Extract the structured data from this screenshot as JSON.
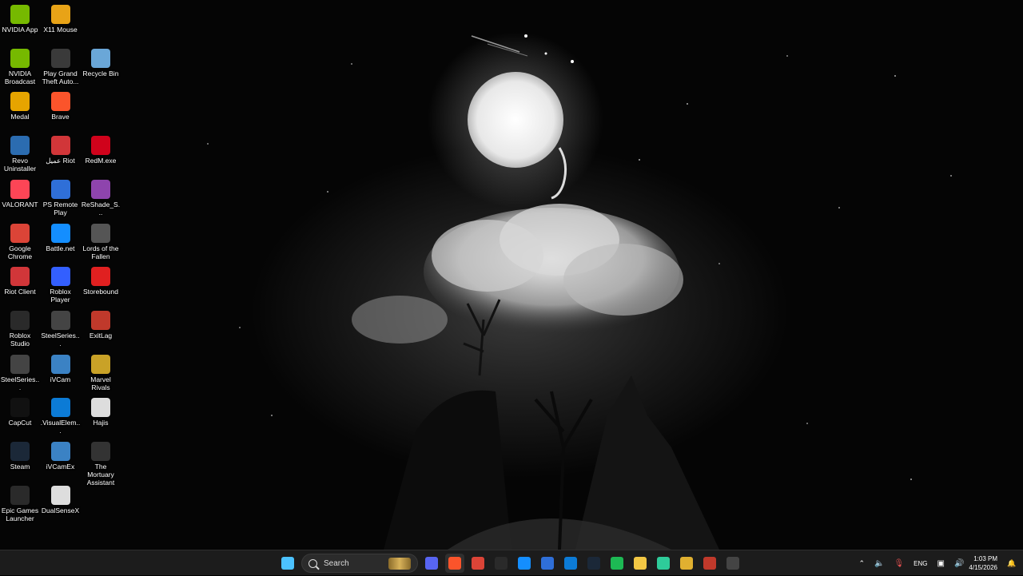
{
  "desktop": {
    "icons": [
      {
        "label": "NVIDIA App",
        "icon": "nvidia-icon",
        "color": "#76b900"
      },
      {
        "label": "X11 Mouse",
        "icon": "mouse-icon",
        "color": "#e8a317"
      },
      {
        "label": "NVIDIA Broadcast",
        "icon": "nvidia-broadcast-icon",
        "color": "#76b900"
      },
      {
        "label": "Play Grand Theft Auto...",
        "icon": "gta-icon",
        "color": "#3a3a3a"
      },
      {
        "label": "Recycle Bin",
        "icon": "recycle-bin-icon",
        "color": "#6aa7d8"
      },
      {
        "label": "Medal",
        "icon": "medal-icon",
        "color": "#e6a400"
      },
      {
        "label": "Brave",
        "icon": "brave-icon",
        "color": "#fb542b"
      },
      {
        "label": "Revo Uninstaller",
        "icon": "revo-icon",
        "color": "#2b6cb0"
      },
      {
        "label": "عميل Riot",
        "icon": "riot-icon",
        "color": "#d13639"
      },
      {
        "label": "RedM.exe",
        "icon": "redm-icon",
        "color": "#d0021b"
      },
      {
        "label": "VALORANT",
        "icon": "valorant-icon",
        "color": "#fd4556"
      },
      {
        "label": "PS Remote Play",
        "icon": "ps-remote-icon",
        "color": "#2f6fd8"
      },
      {
        "label": "ReShade_S...",
        "icon": "reshade-icon",
        "color": "#8e44ad"
      },
      {
        "label": "Google Chrome",
        "icon": "chrome-icon",
        "color": "#db4437"
      },
      {
        "label": "Battle.net",
        "icon": "battlenet-icon",
        "color": "#148eff"
      },
      {
        "label": "Lords of the Fallen",
        "icon": "lords-icon",
        "color": "#555555"
      },
      {
        "label": "Riot Client",
        "icon": "riot-client-icon",
        "color": "#d13639"
      },
      {
        "label": "Roblox Player",
        "icon": "roblox-icon",
        "color": "#335fff"
      },
      {
        "label": "Storebound",
        "icon": "storebound-icon",
        "color": "#e02020"
      },
      {
        "label": "Roblox Studio",
        "icon": "roblox-studio-icon",
        "color": "#2a2a2a"
      },
      {
        "label": "SteelSeries...",
        "icon": "steelseries-icon",
        "color": "#444444"
      },
      {
        "label": "ExitLag",
        "icon": "exitlag-icon",
        "color": "#c0392b"
      },
      {
        "label": "SteelSeries...",
        "icon": "steelseries-icon",
        "color": "#444444"
      },
      {
        "label": "iVCam",
        "icon": "ivcam-icon",
        "color": "#3b82c4"
      },
      {
        "label": "Marvel Rivals",
        "icon": "marvel-rivals-icon",
        "color": "#c9a227"
      },
      {
        "label": "CapCut",
        "icon": "capcut-icon",
        "color": "#111111"
      },
      {
        "label": ".VisualElem...",
        "icon": "edge-icon",
        "color": "#0c7bd6"
      },
      {
        "label": "Hajis",
        "icon": "file-icon",
        "color": "#dddddd"
      },
      {
        "label": "Steam",
        "icon": "steam-icon",
        "color": "#1b2838"
      },
      {
        "label": "iVCamEx",
        "icon": "ivcam-icon",
        "color": "#3b82c4"
      },
      {
        "label": "The Mortuary Assistant",
        "icon": "mortuary-icon",
        "color": "#333333"
      },
      {
        "label": "Epic Games Launcher",
        "icon": "epic-icon",
        "color": "#2a2a2a"
      },
      {
        "label": "DualSenseX",
        "icon": "dualsensex-icon",
        "color": "#dddddd"
      }
    ]
  },
  "taskbar": {
    "search_placeholder": "Search",
    "apps": [
      {
        "name": "start-button",
        "icon": "windows-icon",
        "color": "#4cc2ff"
      },
      {
        "name": "discord-button",
        "icon": "discord-icon",
        "color": "#5865f2"
      },
      {
        "name": "brave-button",
        "icon": "brave-icon",
        "color": "#fb542b"
      },
      {
        "name": "chrome-button",
        "icon": "chrome-icon",
        "color": "#db4437"
      },
      {
        "name": "epic-button",
        "icon": "epic-icon",
        "color": "#2a2a2a"
      },
      {
        "name": "battlenet-button",
        "icon": "battlenet-icon",
        "color": "#148eff"
      },
      {
        "name": "ps-remote-button",
        "icon": "ps-remote-icon",
        "color": "#2f6fd8"
      },
      {
        "name": "edge-button",
        "icon": "edge-icon",
        "color": "#0c7bd6"
      },
      {
        "name": "steam-button",
        "icon": "steam-icon",
        "color": "#1b2838"
      },
      {
        "name": "spotify-button",
        "icon": "spotify-icon",
        "color": "#1db954"
      },
      {
        "name": "file-explorer-button",
        "icon": "folder-icon",
        "color": "#f2c744"
      },
      {
        "name": "app-button",
        "icon": "app-icon",
        "color": "#2ecc9a"
      },
      {
        "name": "discord-alt-button",
        "icon": "discord-alt-icon",
        "color": "#e0b030"
      },
      {
        "name": "app-red-button",
        "icon": "app-red-icon",
        "color": "#c0392b"
      },
      {
        "name": "steelseries-button",
        "icon": "steelseries-icon",
        "color": "#444444"
      }
    ],
    "tray": {
      "language": "ENG",
      "time": "1:03 PM",
      "date": "4/15/2026"
    }
  }
}
